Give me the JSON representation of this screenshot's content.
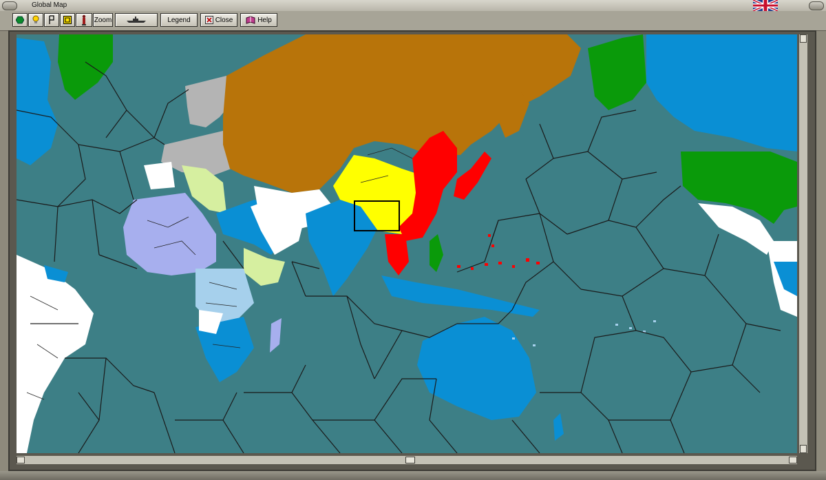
{
  "window": {
    "title": "Global Map"
  },
  "toolbar": {
    "buttons": [
      {
        "icon": "hexagon-icon"
      },
      {
        "icon": "bulb-icon"
      },
      {
        "icon": "flag-p-icon"
      },
      {
        "icon": "grid-icon"
      },
      {
        "icon": "soldier-icon"
      },
      {
        "label": "Zoom"
      },
      {
        "icon": "ship-icon"
      },
      {
        "label": "Legend"
      },
      {
        "label": "Close",
        "icon": "close-icon"
      },
      {
        "label": "Help",
        "icon": "book-icon"
      }
    ]
  },
  "map": {
    "colors": {
      "sea": "#3d7f86",
      "neutral_white": "#ffffff",
      "soviet_brown": "#b8740a",
      "china_yellow": "#ffff00",
      "japan_red": "#ff0000",
      "allied_blue": "#0a8fd4",
      "light_blue": "#a6d0ec",
      "usa_green": "#0a9a0a",
      "lavender": "#a7afee",
      "pale_green": "#d6efa0",
      "grey": "#b4b4b4"
    }
  }
}
